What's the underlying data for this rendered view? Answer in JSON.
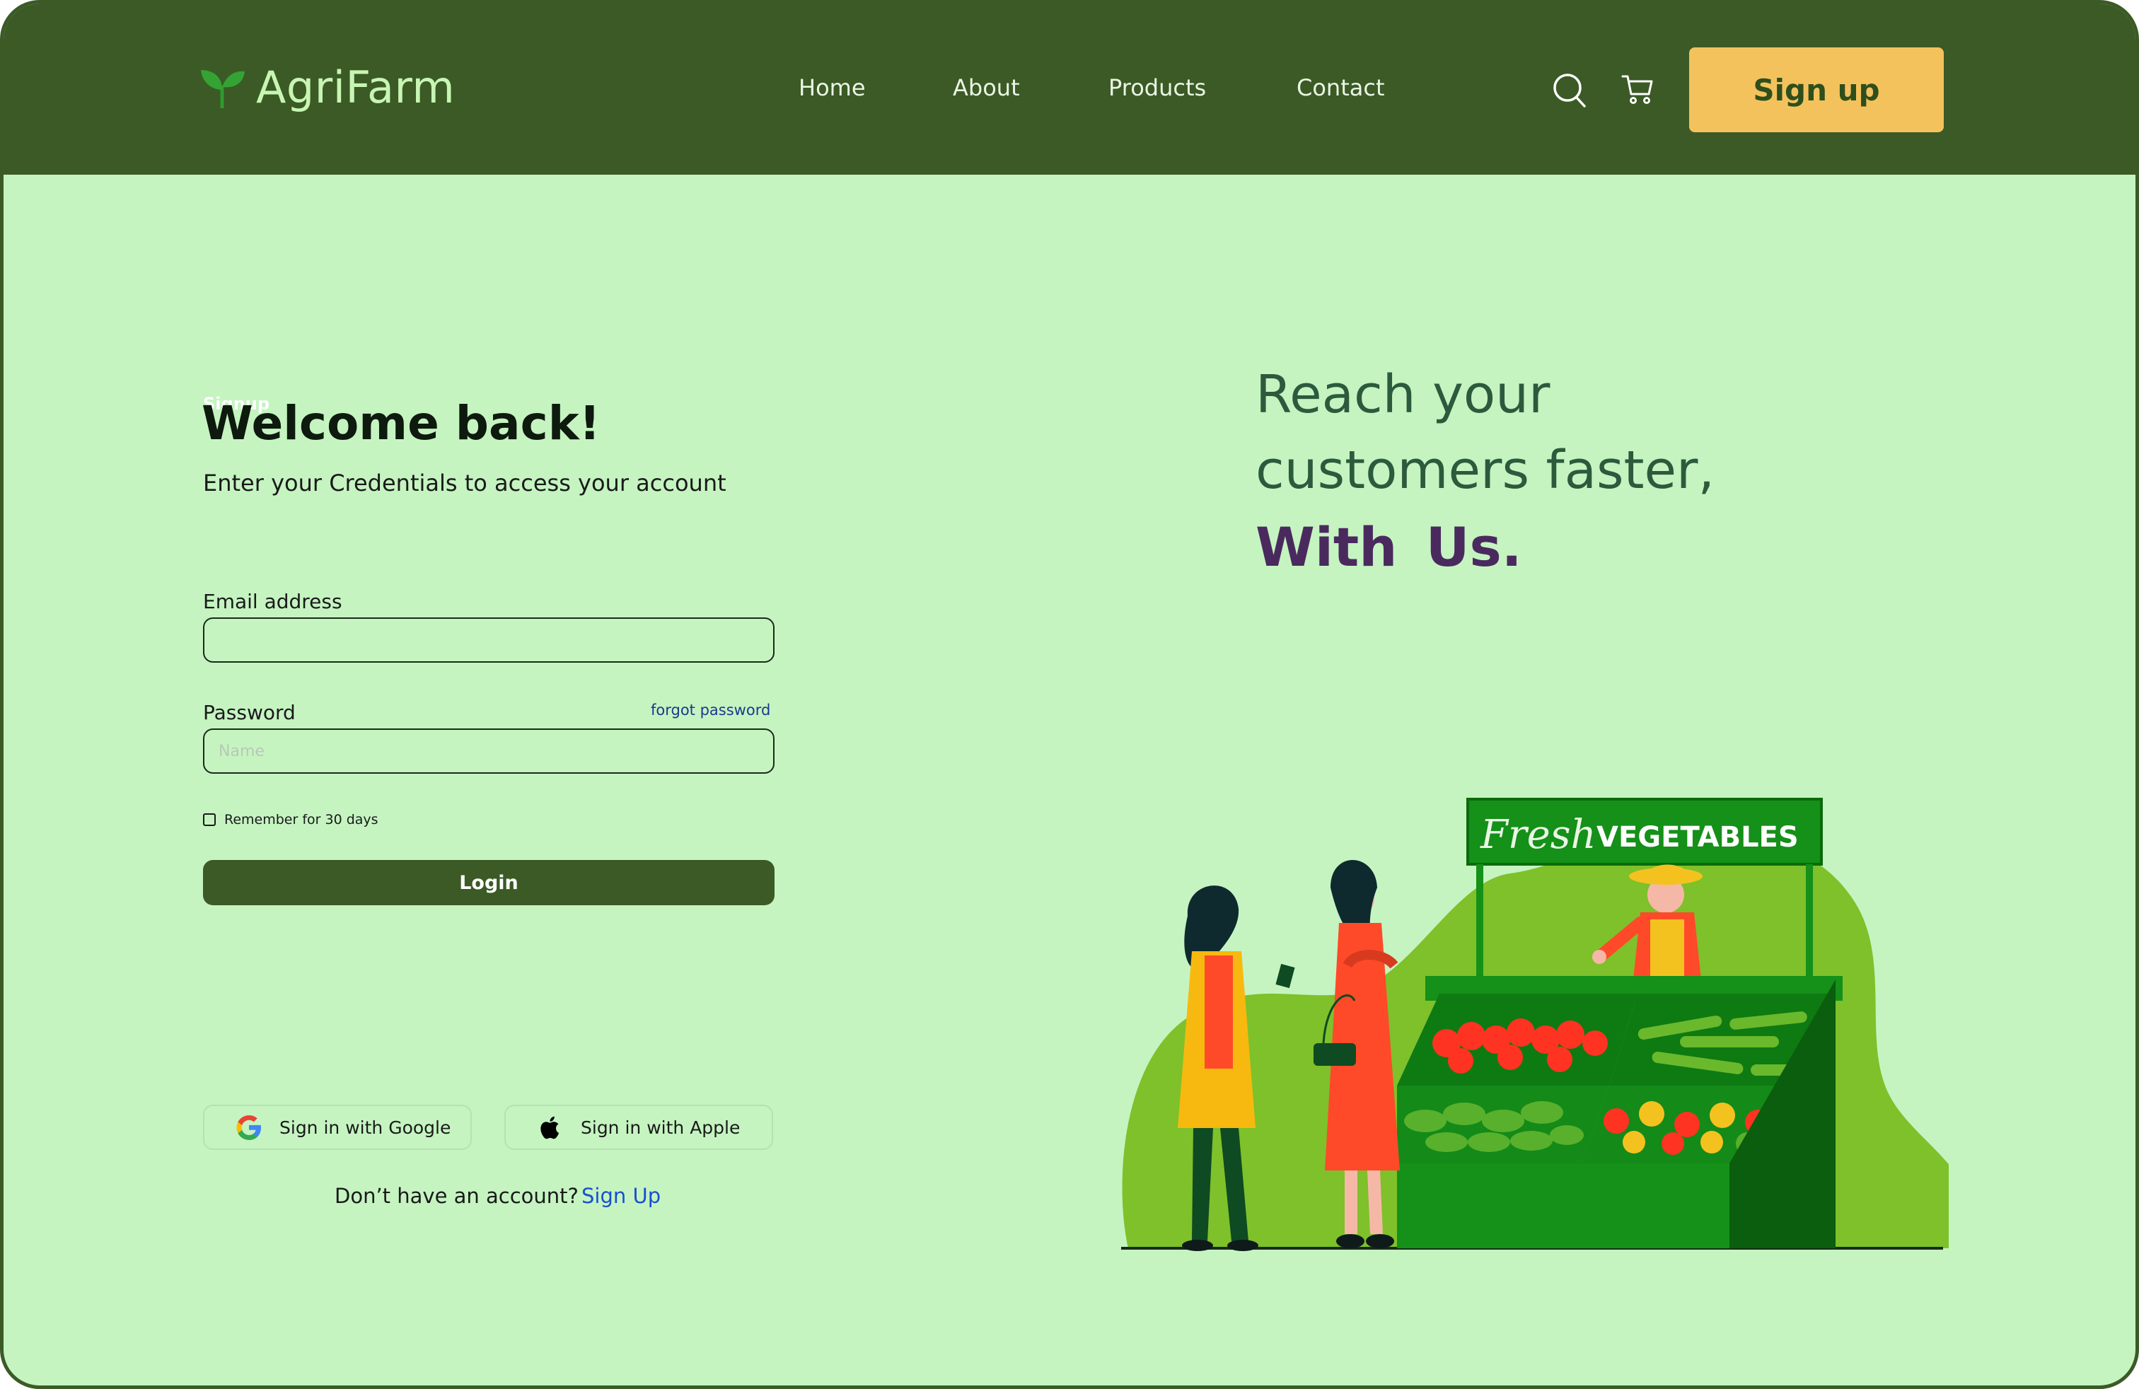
{
  "header": {
    "brand": "AgriFarm",
    "nav": [
      "Home",
      "About",
      "Products",
      "Contact"
    ],
    "signup_label": "Sign up"
  },
  "form": {
    "hidden_label": "Signup",
    "title": "Welcome back!",
    "subtitle": "Enter your Credentials to access your account",
    "email_label": "Email address",
    "email_value": "",
    "password_label": "Password",
    "password_placeholder": "Name",
    "forgot_label": "forgot password",
    "remember_label": "Remember for 30 days",
    "remember_checked": false,
    "login_label": "Login",
    "google_label": "Sign in with Google",
    "apple_label": "Sign in with Apple",
    "no_account_text": "Don’t have an account?",
    "signup_link": "Sign Up"
  },
  "hero": {
    "line1": "Reach your",
    "line2": "customers faster,",
    "line3": "With Us.",
    "sign_script": "Fresh",
    "sign_text": "VEGETABLES"
  },
  "colors": {
    "header_bg": "#3b5a25",
    "page_bg": "#c5f4c1",
    "accent_button": "#f4c25d",
    "tagline": "#2c5a3c",
    "tagline_strong": "#4a2a5e",
    "link": "#1a4fd0"
  },
  "icons": [
    "leaf-logo-icon",
    "search-icon",
    "cart-icon",
    "google-icon",
    "apple-icon"
  ]
}
